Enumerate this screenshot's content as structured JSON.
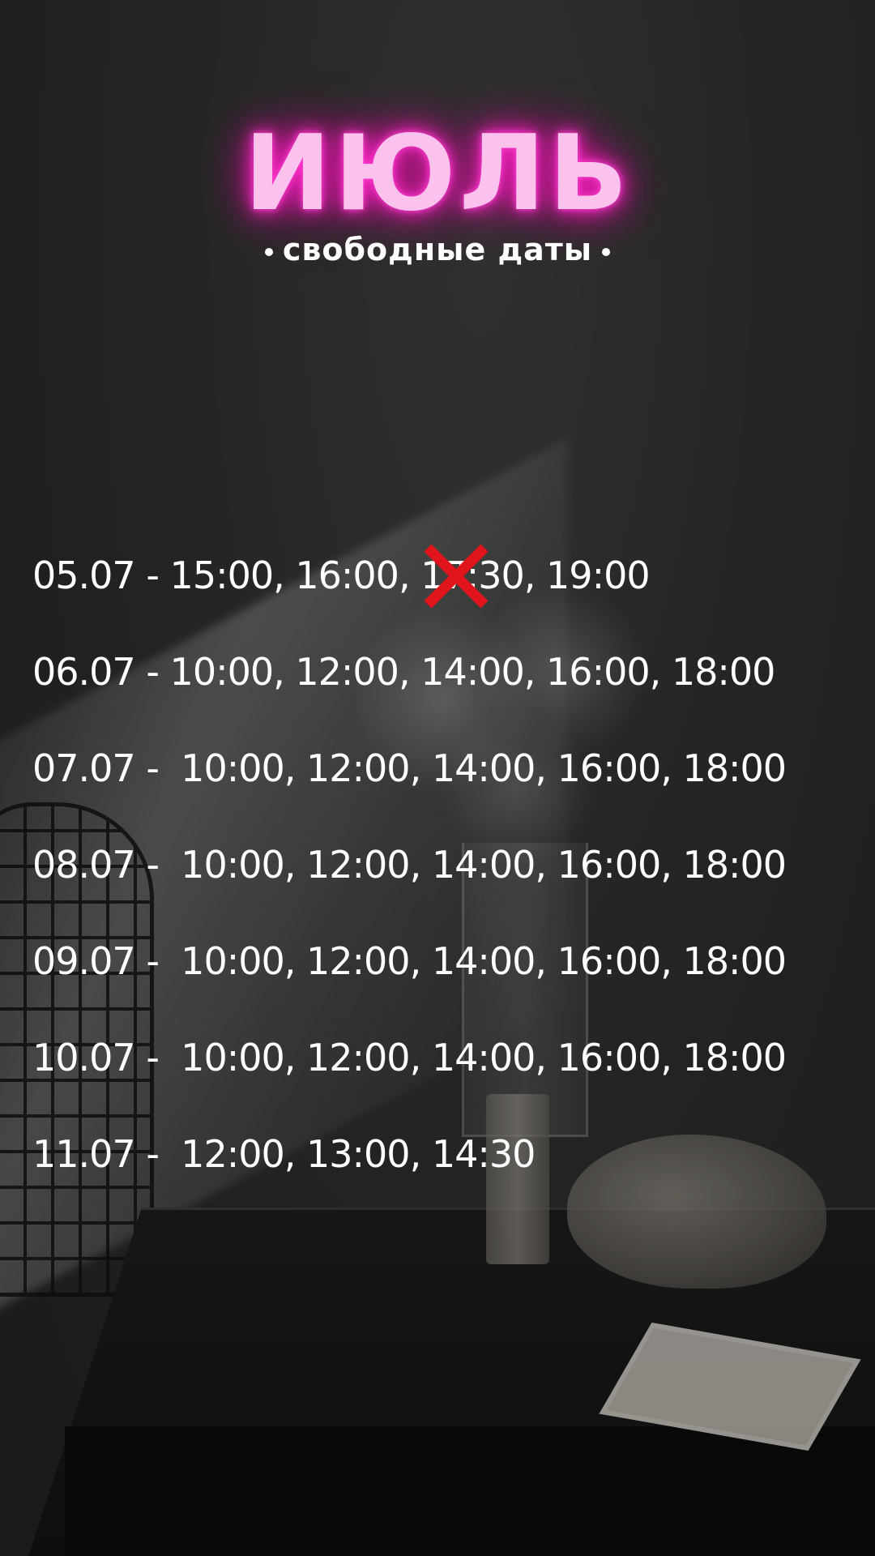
{
  "header": {
    "title": "ИЮЛЬ",
    "subtitle": "свободные даты"
  },
  "colors": {
    "title_glow": "#ff2bcc",
    "title_text": "#fbc2ee",
    "text": "#ffffff",
    "cancel_mark": "#e0141b"
  },
  "schedule": [
    {
      "date": "05.07",
      "sep": " - ",
      "slots": [
        {
          "time": "15:00",
          "cancelled": false
        },
        {
          "time": "16:00",
          "cancelled": false
        },
        {
          "time": "17:30",
          "cancelled": true
        },
        {
          "time": "19:00",
          "cancelled": false
        }
      ]
    },
    {
      "date": "06.07",
      "sep": " - ",
      "slots": [
        {
          "time": "10:00",
          "cancelled": false
        },
        {
          "time": "12:00",
          "cancelled": false
        },
        {
          "time": "14:00",
          "cancelled": false
        },
        {
          "time": "16:00",
          "cancelled": false
        },
        {
          "time": "18:00",
          "cancelled": false
        }
      ]
    },
    {
      "date": "07.07",
      "sep": " -  ",
      "slots": [
        {
          "time": "10:00",
          "cancelled": false
        },
        {
          "time": "12:00",
          "cancelled": false
        },
        {
          "time": "14:00",
          "cancelled": false
        },
        {
          "time": "16:00",
          "cancelled": false
        },
        {
          "time": "18:00",
          "cancelled": false
        }
      ]
    },
    {
      "date": "08.07",
      "sep": " -  ",
      "slots": [
        {
          "time": "10:00",
          "cancelled": false
        },
        {
          "time": "12:00",
          "cancelled": false
        },
        {
          "time": "14:00",
          "cancelled": false
        },
        {
          "time": "16:00",
          "cancelled": false
        },
        {
          "time": "18:00",
          "cancelled": false
        }
      ]
    },
    {
      "date": "09.07",
      "sep": " -  ",
      "slots": [
        {
          "time": "10:00",
          "cancelled": false
        },
        {
          "time": "12:00",
          "cancelled": false
        },
        {
          "time": "14:00",
          "cancelled": false
        },
        {
          "time": "16:00",
          "cancelled": false
        },
        {
          "time": "18:00",
          "cancelled": false
        }
      ]
    },
    {
      "date": "10.07",
      "sep": " -  ",
      "slots": [
        {
          "time": "10:00",
          "cancelled": false
        },
        {
          "time": "12:00",
          "cancelled": false
        },
        {
          "time": "14:00",
          "cancelled": false
        },
        {
          "time": "16:00",
          "cancelled": false
        },
        {
          "time": "18:00",
          "cancelled": false
        }
      ]
    },
    {
      "date": "11.07",
      "sep": " -  ",
      "slots": [
        {
          "time": "12:00",
          "cancelled": false
        },
        {
          "time": "13:00",
          "cancelled": false
        },
        {
          "time": "14:30",
          "cancelled": false
        }
      ]
    }
  ]
}
